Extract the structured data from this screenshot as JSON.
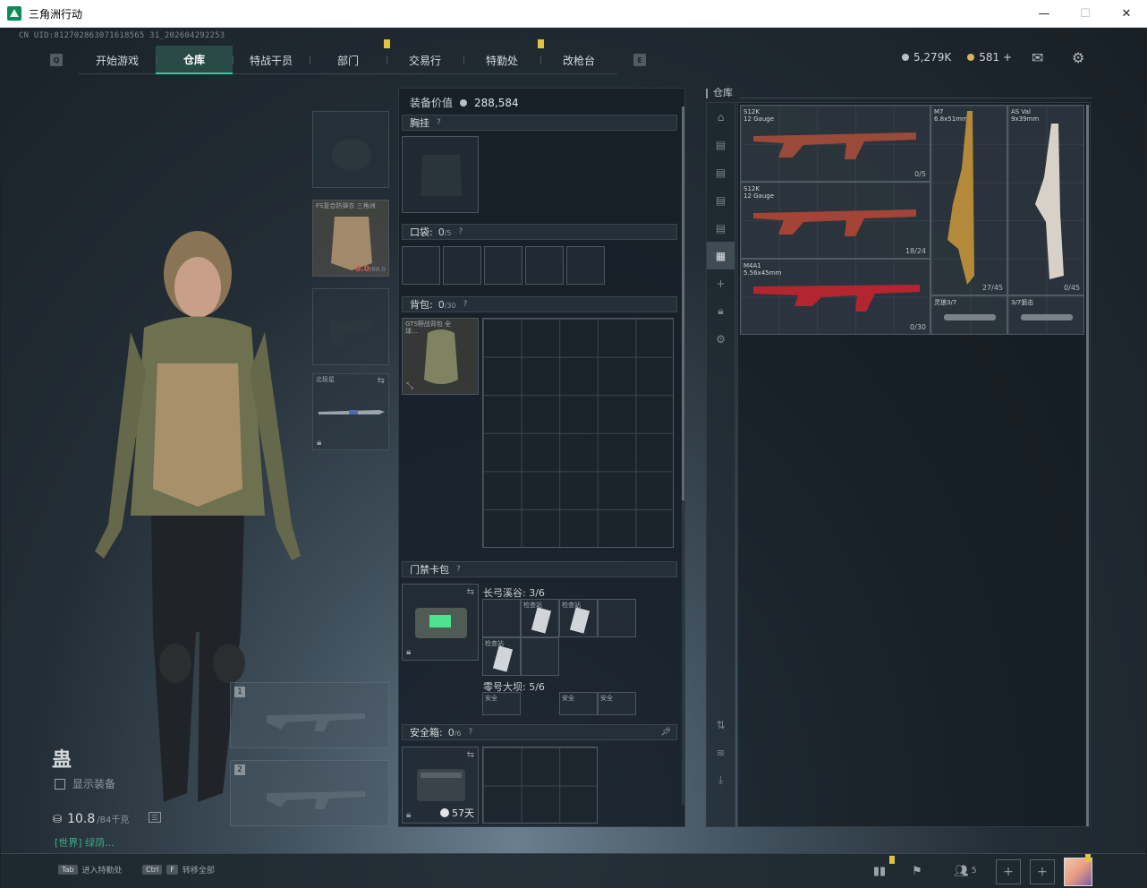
{
  "window": {
    "title": "三角洲行动",
    "controls": {
      "minimize": "—",
      "maximize": "☐",
      "close": "✕"
    }
  },
  "header": {
    "uid": "CN UID:812702863071618565 31_202604292253",
    "left_key": "Q",
    "right_key": "E",
    "tabs": [
      {
        "label": "开始游戏",
        "active": false
      },
      {
        "label": "仓库",
        "active": true
      },
      {
        "label": "特战干员",
        "active": false
      },
      {
        "label": "部门",
        "active": false
      },
      {
        "label": "交易行",
        "active": false
      },
      {
        "label": "特勤处",
        "active": false
      },
      {
        "label": "改枪台",
        "active": false
      }
    ],
    "currency_silver": "5,279K",
    "currency_gold": "581",
    "gold_add": "+",
    "mail_icon": "mail-icon",
    "settings_icon": "gear-icon"
  },
  "character": {
    "emblem": "蛊",
    "show_equipment_label": "显示装备",
    "weight_value": "10.8",
    "weight_max": "/84千克",
    "chat_channel": "[世界]",
    "chat_name": "绿荫",
    "chat_suffix": "..."
  },
  "equipment": {
    "armor_label": "FS复合防弹衣 三角洲",
    "armor_durability": "0.0",
    "armor_durability_max": "/88.0",
    "melee_label": "北极星",
    "weapon_slot_1": "1",
    "weapon_slot_2": "2"
  },
  "loadout": {
    "value_label": "装备价值",
    "value": "288,584",
    "chest_rig_label": "胸挂",
    "pockets_label": "口袋:",
    "pockets_count": "0",
    "pockets_max": "/5",
    "backpack_label": "背包:",
    "backpack_count": "0",
    "backpack_max": "/30",
    "backpack_item_label": "GTS野战背包 全球…",
    "keycard_label": "门禁卡包",
    "keycard_map_1": "长弓溪谷: 3/6",
    "keycard_map_2": "零号大坝: 5/6",
    "keycard_item_a": "检查站",
    "keycard_item_b": "检查站",
    "keycard_item_c": "检查站",
    "keycard_item_d": "安全",
    "keycard_item_e": "安全",
    "keycard_item_f": "安全",
    "safe_box_label": "安全箱:",
    "safe_box_count": "0",
    "safe_box_max": "/6",
    "safe_box_timer": "57天",
    "help_mark": "?"
  },
  "warehouse": {
    "title": "仓库",
    "guns": [
      {
        "name": "S12K",
        "caliber": "12 Gauge",
        "ammo": "0/5"
      },
      {
        "name": "S12K",
        "caliber": "12 Gauge",
        "ammo": "18/24"
      },
      {
        "name": "M4A1",
        "caliber": "5.56x45mm",
        "ammo": "0/30"
      },
      {
        "name": "M7",
        "caliber": "6.8x51mm",
        "ammo": "27/45"
      },
      {
        "name": "AS Val",
        "caliber": "9x39mm",
        "ammo": "0/45"
      },
      {
        "name": "灵狼3/7",
        "caliber": "",
        "ammo": ""
      },
      {
        "name": "3/7狙击",
        "caliber": "",
        "ammo": ""
      }
    ]
  },
  "bottom": {
    "hint_1_key": "Tab",
    "hint_1_text": "进入特勤处",
    "hint_2_key1": "Ctrl",
    "hint_2_key2": "F",
    "hint_2_text": "转移全部",
    "friends_count": "5"
  }
}
